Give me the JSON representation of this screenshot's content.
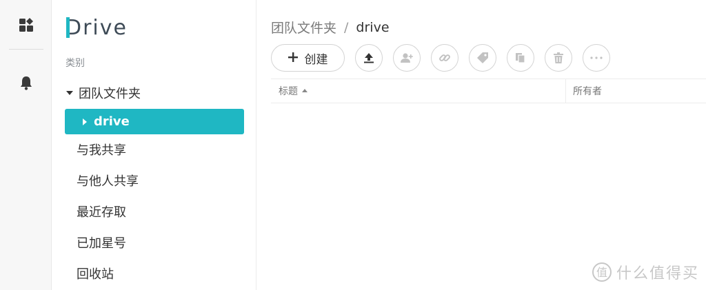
{
  "logo": {
    "text": "Drive"
  },
  "sidebar": {
    "section_label": "类别",
    "team_folder": "团队文件夹",
    "team_sub": "drive",
    "items": [
      {
        "label": "与我共享",
        "icon": "share-icon"
      },
      {
        "label": "与他人共享",
        "icon": "share-icon"
      },
      {
        "label": "最近存取",
        "icon": "clock-icon"
      },
      {
        "label": "已加星号",
        "icon": "star-icon"
      },
      {
        "label": "回收站",
        "icon": "trash-icon"
      }
    ]
  },
  "breadcrumb": {
    "root": "团队文件夹",
    "separator": "/",
    "current": "drive"
  },
  "toolbar": {
    "create_label": "创建",
    "icons": [
      "upload-icon",
      "add-user-icon",
      "link-icon",
      "tag-icon",
      "copy-icon",
      "delete-icon",
      "more-icon"
    ]
  },
  "table": {
    "columns": [
      "标题",
      "所有者"
    ]
  },
  "watermark": {
    "text": "什么值得买"
  },
  "colors": {
    "accent": "#1fb7c3",
    "icon_gray": "#bdbdbd",
    "dark_icon": "#3a3a3a"
  }
}
